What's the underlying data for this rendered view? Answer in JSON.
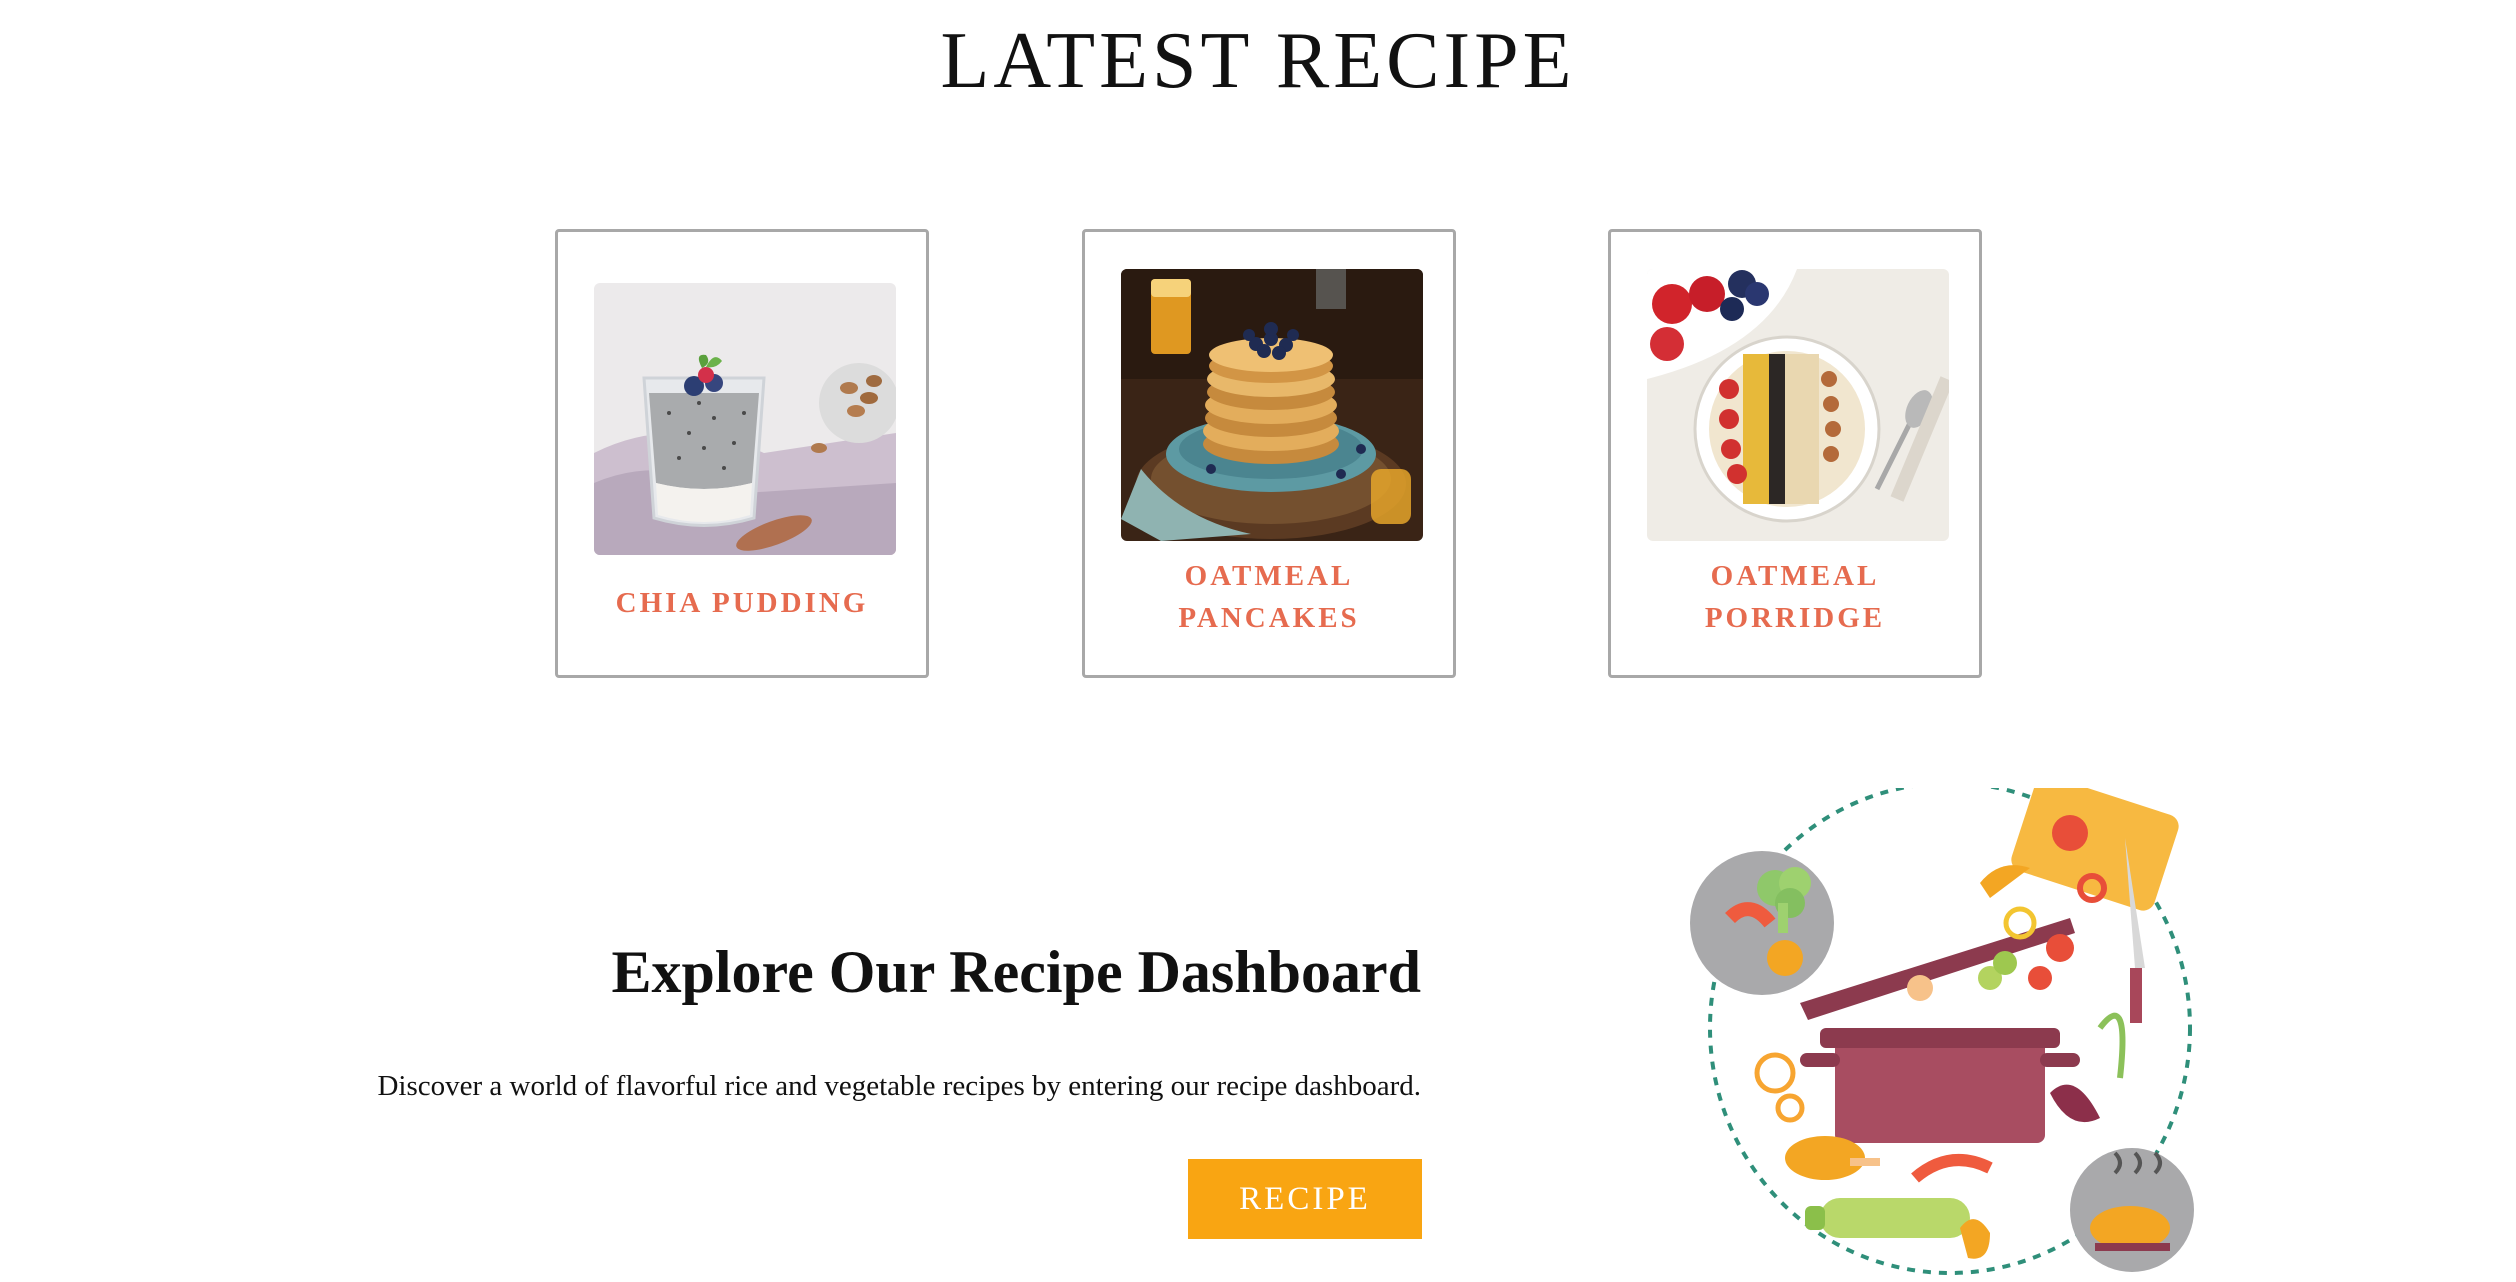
{
  "section": {
    "title": "LATEST RECIPE"
  },
  "recipes": [
    {
      "name": "CHIA PUDDING",
      "image": "chia-pudding-photo"
    },
    {
      "name": "OATMEAL PANCAKES",
      "image": "oatmeal-pancakes-photo"
    },
    {
      "name": "OATMEAL PORRIDGE",
      "image": "oatmeal-porridge-photo"
    }
  ],
  "explore": {
    "heading": "Explore Our Recipe Dashboard",
    "description": "Discover a world of flavorful rice and vegetable recipes by entering our recipe dashboard.",
    "button_label": "RECIPE"
  },
  "colors": {
    "accent": "#e66b4f",
    "button": "#f9a512",
    "card_border": "#a8a8a8"
  }
}
